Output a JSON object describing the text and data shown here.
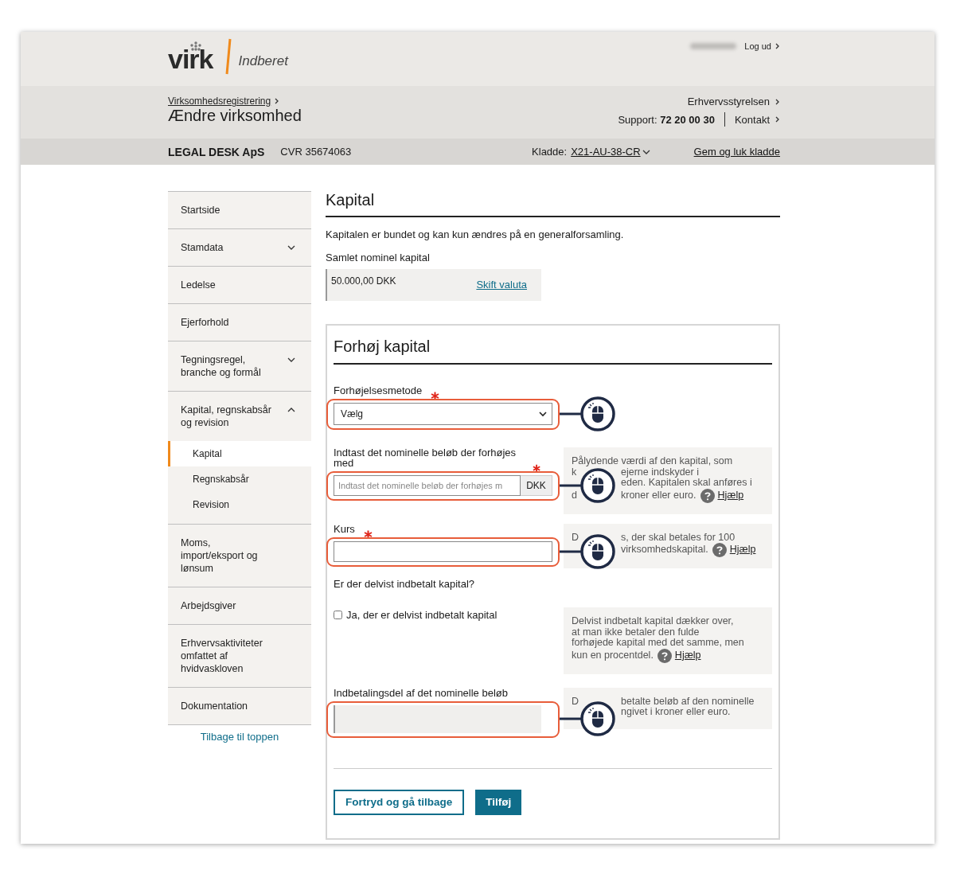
{
  "header": {
    "logo": "virk",
    "product": "Indberet",
    "user_blurred": true,
    "logout": "Log ud"
  },
  "subheader": {
    "breadcrumb": "Virksomhedsregistrering",
    "title": "Ændre virksomhed",
    "agency": "Erhvervsstyrelsen",
    "support": "Support: **72 20 00 30**",
    "contact": "Kontakt"
  },
  "company_bar": {
    "name": "LEGAL DESK ApS",
    "cvr": "CVR 35674063",
    "draft_label": "Kladde:",
    "draft_id": "X21-AU-38-CR",
    "save_close": "Gem og luk kladde"
  },
  "sidebar": {
    "items": [
      {
        "label": "Startside",
        "selected": false
      },
      {
        "label": "Stamdata",
        "selected": false,
        "expanded": false
      },
      {
        "label": "Ledelse",
        "selected": false
      },
      {
        "label": "Ejerforhold",
        "selected": false
      },
      {
        "label": "Tegningsregel, branche og formål",
        "selected": false,
        "expanded": false
      },
      {
        "label": "Kapital, regnskabsår og revision",
        "selected": false,
        "expanded": true,
        "children": [
          {
            "label": "Kapital",
            "selected": true
          },
          {
            "label": "Regnskabsår",
            "selected": false
          },
          {
            "label": "Revision",
            "selected": false
          }
        ]
      },
      {
        "label": "Moms, import/eksport og lønsum",
        "selected": false
      },
      {
        "label": "Arbejdsgiver",
        "selected": false
      },
      {
        "label": "Erhvervsaktiviteter omfattet af hvidvaskloven",
        "selected": false
      },
      {
        "label": "Dokumentation",
        "selected": false
      }
    ],
    "back_to_top": "Tilbage til toppen"
  },
  "main": {
    "title": "Kapital",
    "intro": "Kapitalen er bundet og kan kun ændres på en generalforsamling.",
    "total_label": "Samlet nominel kapital",
    "total_value": "50.000,00 DKK",
    "change_currency": "Skift valuta"
  },
  "form": {
    "title": "Forhøj kapital",
    "fields": [
      {
        "kind": "select",
        "label": "Forhøjelsesmetode",
        "required": true,
        "value": "Vælg",
        "highlighted": true
      },
      {
        "kind": "input",
        "label": "Indtast det nominelle beløb der forhøjes med",
        "required": true,
        "placeholder": "Indtast det nominelle beløb der forhøjes m",
        "suffix": "DKK",
        "highlighted": true,
        "help": {
          "lines": [
            {
              "text": "Pålydende værdi af den kapital, som"
            },
            {
              "left": "k",
              "right": "ejerne indskyder i"
            },
            {
              "right": "eden. Kapitalen skal anføres i"
            },
            {
              "left": "d",
              "right": "kroner eller euro."
            }
          ],
          "link": "Hjælp"
        }
      },
      {
        "kind": "input",
        "label": "Kurs",
        "required": true,
        "highlighted": true,
        "help": {
          "lines": [
            {
              "left": "D",
              "right": "s, der skal betales for 100"
            },
            {
              "right": "virksomhedskapital."
            }
          ],
          "link": "Hjælp"
        }
      },
      {
        "kind": "question",
        "label": "Er der delvist indbetalt kapital?"
      },
      {
        "kind": "checkbox",
        "label": "Ja, der er delvist indbetalt kapital",
        "checked": false,
        "help": {
          "lines": [
            {
              "text": "Delvist indbetalt kapital dækker over,"
            },
            {
              "text": "at man ikke betaler den fulde"
            },
            {
              "text": "forhøjede kapital med det samme, men"
            },
            {
              "text": "kun en procentdel."
            }
          ],
          "link": "Hjælp"
        }
      },
      {
        "kind": "input",
        "label": "Indbetalingsdel af det nominelle beløb",
        "required": false,
        "disabled": true,
        "highlighted": true,
        "help": {
          "lines": [
            {
              "left": "D",
              "right": "betalte beløb af den nominelle"
            },
            {
              "right": "ngivet i kroner eller euro."
            }
          ]
        }
      }
    ],
    "buttons": [
      {
        "label": "Fortryd og gå tilbage",
        "kind": "secondary"
      },
      {
        "label": "Tilføj",
        "kind": "primary"
      }
    ]
  }
}
